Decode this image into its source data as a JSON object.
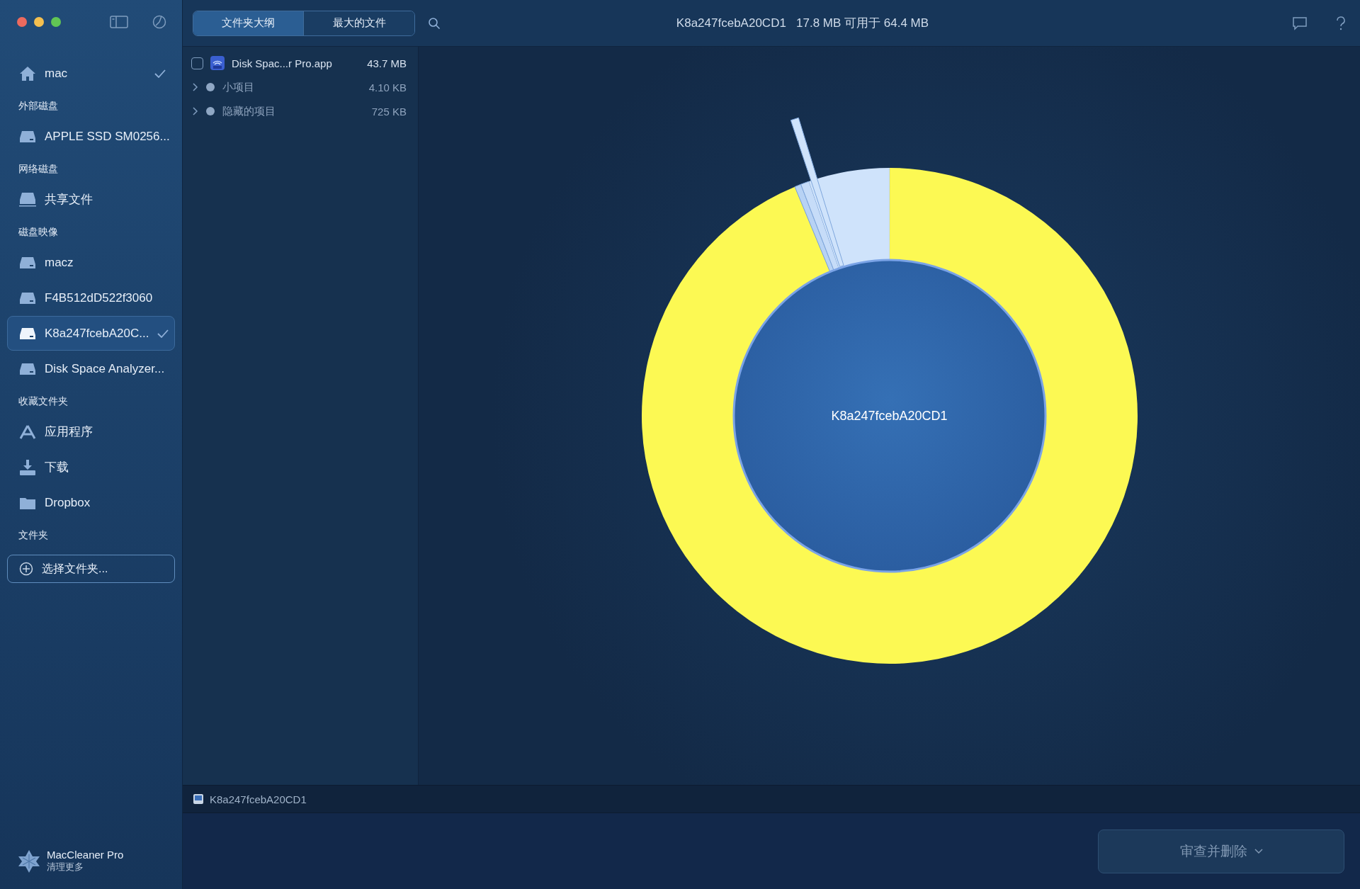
{
  "sidebar": {
    "sections": [
      {
        "items": [
          {
            "kind": "home",
            "label": "mac",
            "checked": true,
            "selected": false
          }
        ]
      },
      {
        "header": "外部磁盘",
        "items": [
          {
            "kind": "disk",
            "label": "APPLE SSD SM0256...",
            "checked": false,
            "selected": false
          }
        ]
      },
      {
        "header": "网络磁盘",
        "items": [
          {
            "kind": "network",
            "label": "共享文件",
            "checked": false,
            "selected": false
          }
        ]
      },
      {
        "header": "磁盘映像",
        "items": [
          {
            "kind": "disk",
            "label": "macz",
            "checked": false,
            "selected": false
          },
          {
            "kind": "disk",
            "label": "F4B512dD522f3060",
            "checked": false,
            "selected": false
          },
          {
            "kind": "disk",
            "label": "K8a247fcebA20C...",
            "checked": true,
            "selected": true
          },
          {
            "kind": "disk",
            "label": "Disk Space Analyzer...",
            "checked": false,
            "selected": false
          }
        ]
      },
      {
        "header": "收藏文件夹",
        "items": [
          {
            "kind": "apps",
            "label": "应用程序",
            "checked": false,
            "selected": false
          },
          {
            "kind": "download",
            "label": "下载",
            "checked": false,
            "selected": false
          },
          {
            "kind": "folder",
            "label": "Dropbox",
            "checked": false,
            "selected": false
          }
        ]
      },
      {
        "header": "文件夹",
        "button": "选择文件夹..."
      }
    ],
    "promo": {
      "title": "MacCleaner Pro",
      "subtitle": "清理更多"
    }
  },
  "tabs": [
    {
      "label": "文件夹大纲",
      "selected": true
    },
    {
      "label": "最大的文件",
      "selected": false
    }
  ],
  "disk_info": {
    "name": "K8a247fcebA20CD1",
    "summary": "17.8 MB 可用于 64.4 MB"
  },
  "files": [
    {
      "kind": "app",
      "name": "Disk Spac...r Pro.app",
      "size": "43.7 MB",
      "checked": false
    },
    {
      "kind": "group",
      "name": "小项目",
      "size": "4.10 KB",
      "expanded": false
    },
    {
      "kind": "group",
      "name": "隐藏的项目",
      "size": "725 KB",
      "expanded": false
    }
  ],
  "chart": {
    "center_label": "K8a247fcebA20CD1"
  },
  "path_bar": {
    "label": "K8a247fcebA20CD1"
  },
  "action_button": {
    "label": "审查并删除"
  }
}
